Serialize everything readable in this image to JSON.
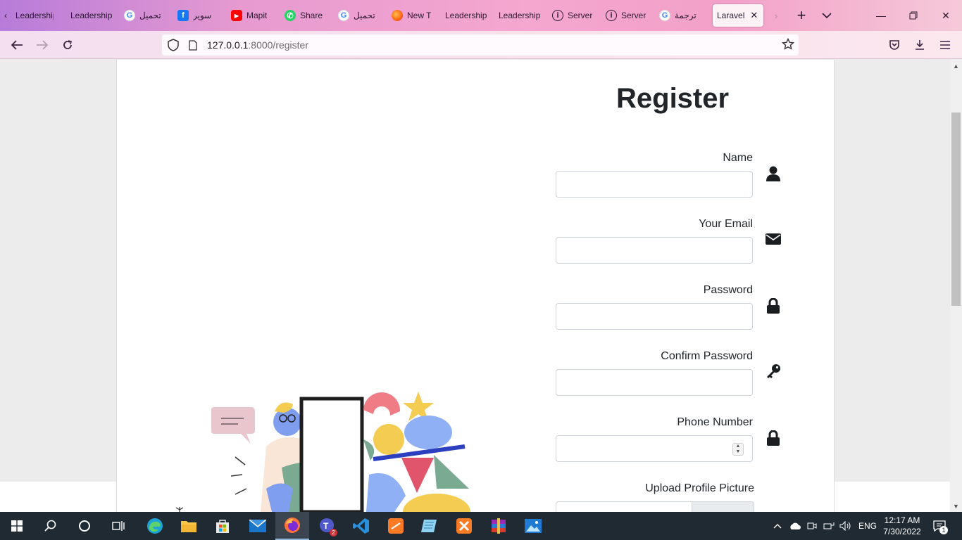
{
  "browser": {
    "tabs": [
      {
        "label": "Leadership",
        "icon": "leadership-icon"
      },
      {
        "label": "Leadership",
        "icon": "leadership-icon"
      },
      {
        "label": "تحميل",
        "icon": "google-icon"
      },
      {
        "label": "سوير",
        "icon": "facebook-icon"
      },
      {
        "label": "Mapit",
        "icon": "youtube-icon"
      },
      {
        "label": "Share",
        "icon": "whatsapp-icon"
      },
      {
        "label": "تحميل",
        "icon": "google-icon"
      },
      {
        "label": "New T",
        "icon": "firefox-icon"
      },
      {
        "label": "Leadership",
        "icon": "leadership-icon"
      },
      {
        "label": "Leadership",
        "icon": "leadership-icon"
      },
      {
        "label": "Server",
        "icon": "info-icon"
      },
      {
        "label": "Server",
        "icon": "info-icon"
      },
      {
        "label": "ترجمة",
        "icon": "google-icon"
      }
    ],
    "active_tab": {
      "label": "Laravel",
      "close": "✕"
    },
    "url": {
      "host": "127.0.0.1",
      "path": ":8000/register"
    }
  },
  "form": {
    "title": "Register",
    "fields": [
      {
        "label": "Name",
        "icon": "user-icon",
        "value": ""
      },
      {
        "label": "Your Email",
        "icon": "envelope-icon",
        "value": ""
      },
      {
        "label": "Password",
        "icon": "lock-icon",
        "value": ""
      },
      {
        "label": "Confirm Password",
        "icon": "key-icon",
        "value": ""
      },
      {
        "label": "Phone Number",
        "icon": "lock-icon",
        "value": ""
      }
    ],
    "upload": {
      "label": "Upload Profile Picture"
    }
  },
  "taskbar": {
    "time": "12:17 AM",
    "date": "7/30/2022",
    "language": "ENG",
    "teams_badge": "2",
    "notification_count": "1"
  },
  "colors": {
    "tab_gradient_start": "#b77bd9",
    "tab_gradient_end": "#f6c9d9",
    "text_dark": "#212529",
    "input_border": "#ced4da",
    "taskbar_bg": "#202a33"
  }
}
